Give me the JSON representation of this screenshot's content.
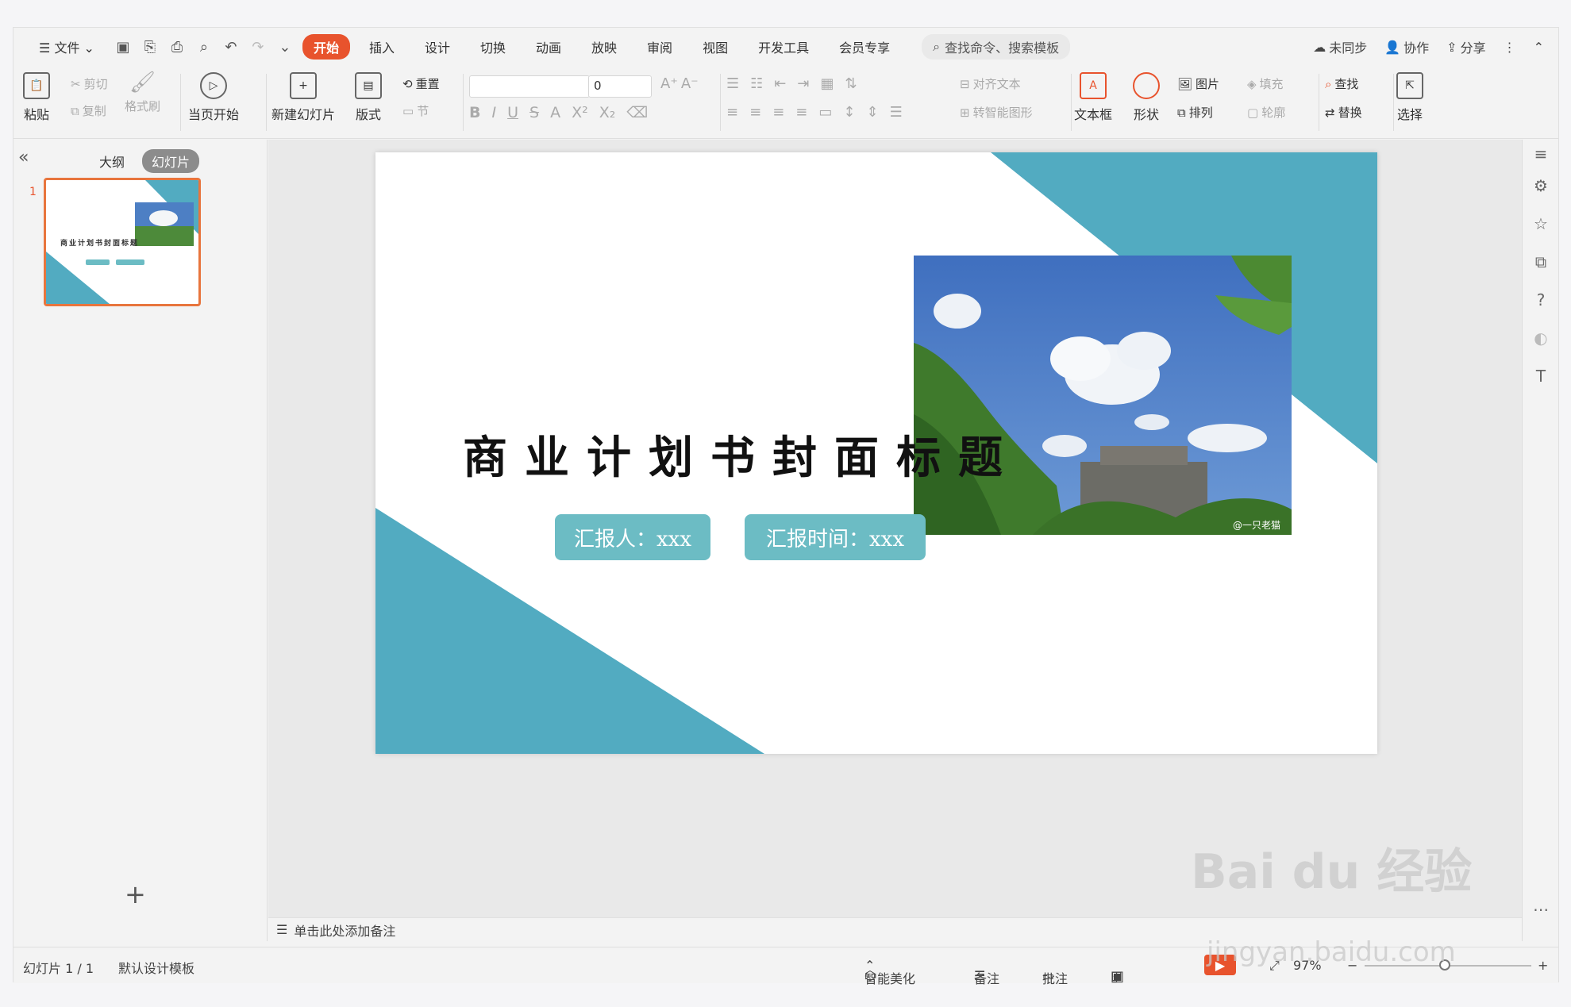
{
  "menubar": {
    "file": "文件",
    "tabs": [
      "开始",
      "插入",
      "设计",
      "切换",
      "动画",
      "放映",
      "审阅",
      "视图",
      "开发工具",
      "会员专享"
    ],
    "active_tab": "开始",
    "search_placeholder": "查找命令、搜索模板",
    "unsynced": "未同步",
    "collab": "协作",
    "share": "分享"
  },
  "ribbon": {
    "paste": "粘贴",
    "cut": "剪切",
    "copy": "复制",
    "format_painter": "格式刷",
    "from_current": "当页开始",
    "new_slide": "新建幻灯片",
    "layout": "版式",
    "reset": "重置",
    "section": "节",
    "font_name": "",
    "font_size": "0",
    "align_text": "对齐文本",
    "smart_art": "转智能图形",
    "textbox": "文本框",
    "shape": "形状",
    "picture": "图片",
    "fill": "填充",
    "arrange": "排列",
    "outline": "轮廓",
    "find": "查找",
    "replace": "替换",
    "select": "选择"
  },
  "leftpanel": {
    "outline_tab": "大纲",
    "slides_tab": "幻灯片",
    "thumb_number": "1",
    "thumb_title": "商业计划书封面标题",
    "thumb_pill1": "汇报人：xxx",
    "thumb_pill2": "汇报时间：xxx"
  },
  "slide": {
    "title": "商业计划书封面标题",
    "reporter": "汇报人：xxx",
    "report_time": "汇报时间：xxx",
    "photo_caption": "@一只老猫",
    "accent_color": "#52abc1",
    "pill_color": "#6cbcc4"
  },
  "notes": {
    "placeholder": "单击此处添加备注"
  },
  "status": {
    "slide_count": "幻灯片 1 / 1",
    "template": "默认设计模板",
    "beautify": "智能美化",
    "notes": "备注",
    "comments": "批注",
    "zoom": "97%"
  },
  "watermark": {
    "line1": "Bai du 经验",
    "line2": "jingyan.baidu.com"
  }
}
